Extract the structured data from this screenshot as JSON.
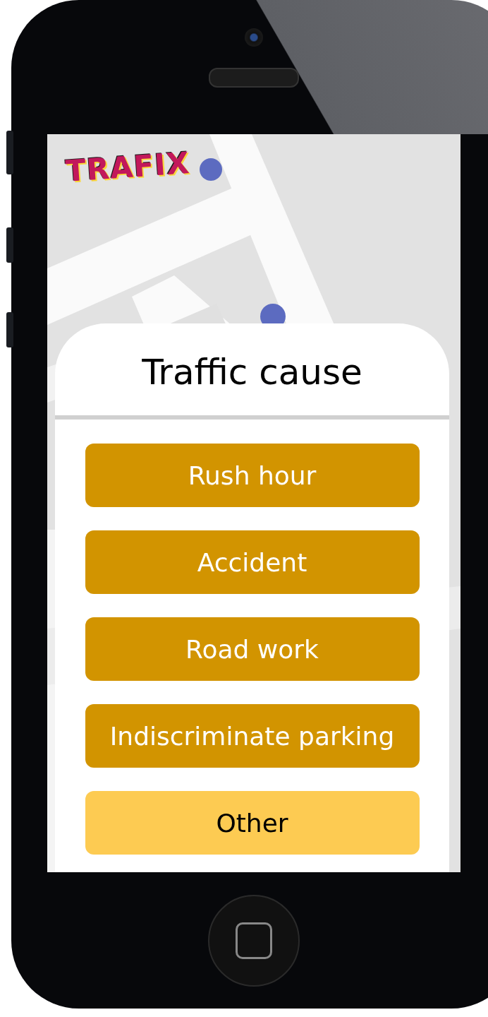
{
  "app": {
    "logo": "TRAFIX"
  },
  "sheet": {
    "title": "Traffic cause",
    "options": [
      {
        "label": "Rush hour",
        "selected": false
      },
      {
        "label": "Accident",
        "selected": false
      },
      {
        "label": "Road work",
        "selected": false
      },
      {
        "label": "Indiscriminate parking",
        "selected": false
      },
      {
        "label": "Other",
        "selected": true
      }
    ]
  }
}
